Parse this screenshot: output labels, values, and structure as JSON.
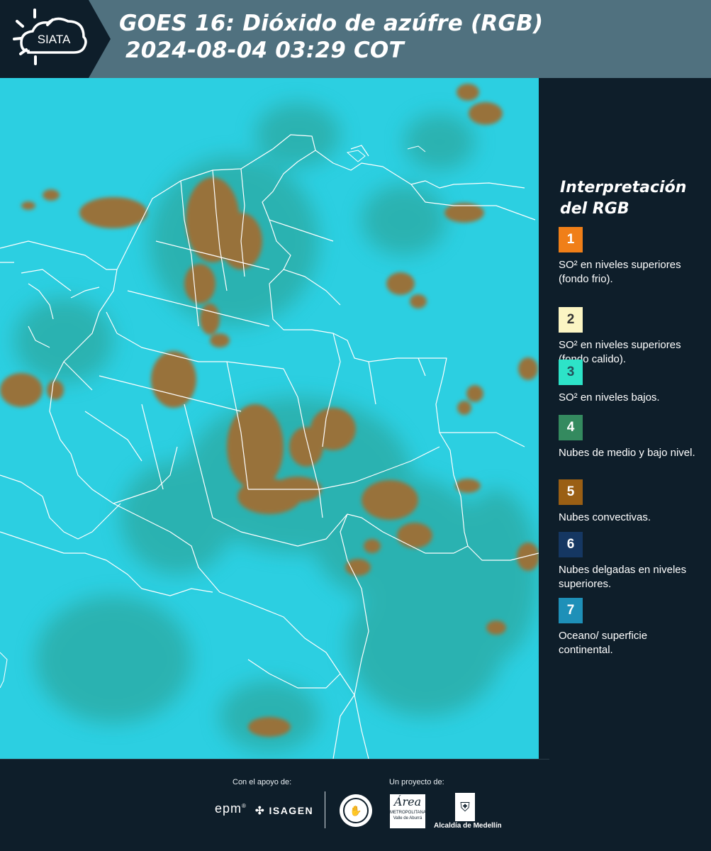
{
  "header": {
    "logo_text": "SIATA",
    "title_line1": "GOES 16: Dióxido de azúfre (RGB)",
    "title_line2": "2024-08-04 03:29 COT"
  },
  "legend": {
    "title_line1": "Interpretación",
    "title_line2": "del RGB",
    "items": [
      {
        "number": "1",
        "color": "#f07f18",
        "text_color": "#ffffff",
        "description": "SO² en niveles superiores (fondo frio)."
      },
      {
        "number": "2",
        "color": "#fbf5c3",
        "text_color": "#333333",
        "description": "SO² en niveles superiores (fondo calido)."
      },
      {
        "number": "3",
        "color": "#2de3c8",
        "text_color": "#23505a",
        "description": "SO² en niveles bajos."
      },
      {
        "number": "4",
        "color": "#348a5f",
        "text_color": "#ffffff",
        "description": "Nubes de medio y bajo nivel."
      },
      {
        "number": "5",
        "color": "#9a5f14",
        "text_color": "#ffffff",
        "description": "Nubes convectivas."
      },
      {
        "number": "6",
        "color": "#153762",
        "text_color": "#ffffff",
        "description": "Nubes delgadas en niveles superiores."
      },
      {
        "number": "7",
        "color": "#1e90b8",
        "text_color": "#ffffff",
        "description": "Oceano/ superficie continental."
      }
    ]
  },
  "footer": {
    "support_label": "Con el apoyo de:",
    "project_label": "Un proyecto de:",
    "sponsor_epm": "epm",
    "sponsor_isagen": "ISAGEN",
    "sponsor_area_line1": "Área",
    "sponsor_area_line2": "METROPOLITANA",
    "sponsor_area_line3": "Valle de Aburrá",
    "sponsor_alcaldia": "Alcaldía de Medellín"
  },
  "map": {
    "background_color": "#2bd0e2",
    "convective_color": "#98723a",
    "midlevel_color": "#2f9d8e",
    "border_color": "#ffffff"
  }
}
